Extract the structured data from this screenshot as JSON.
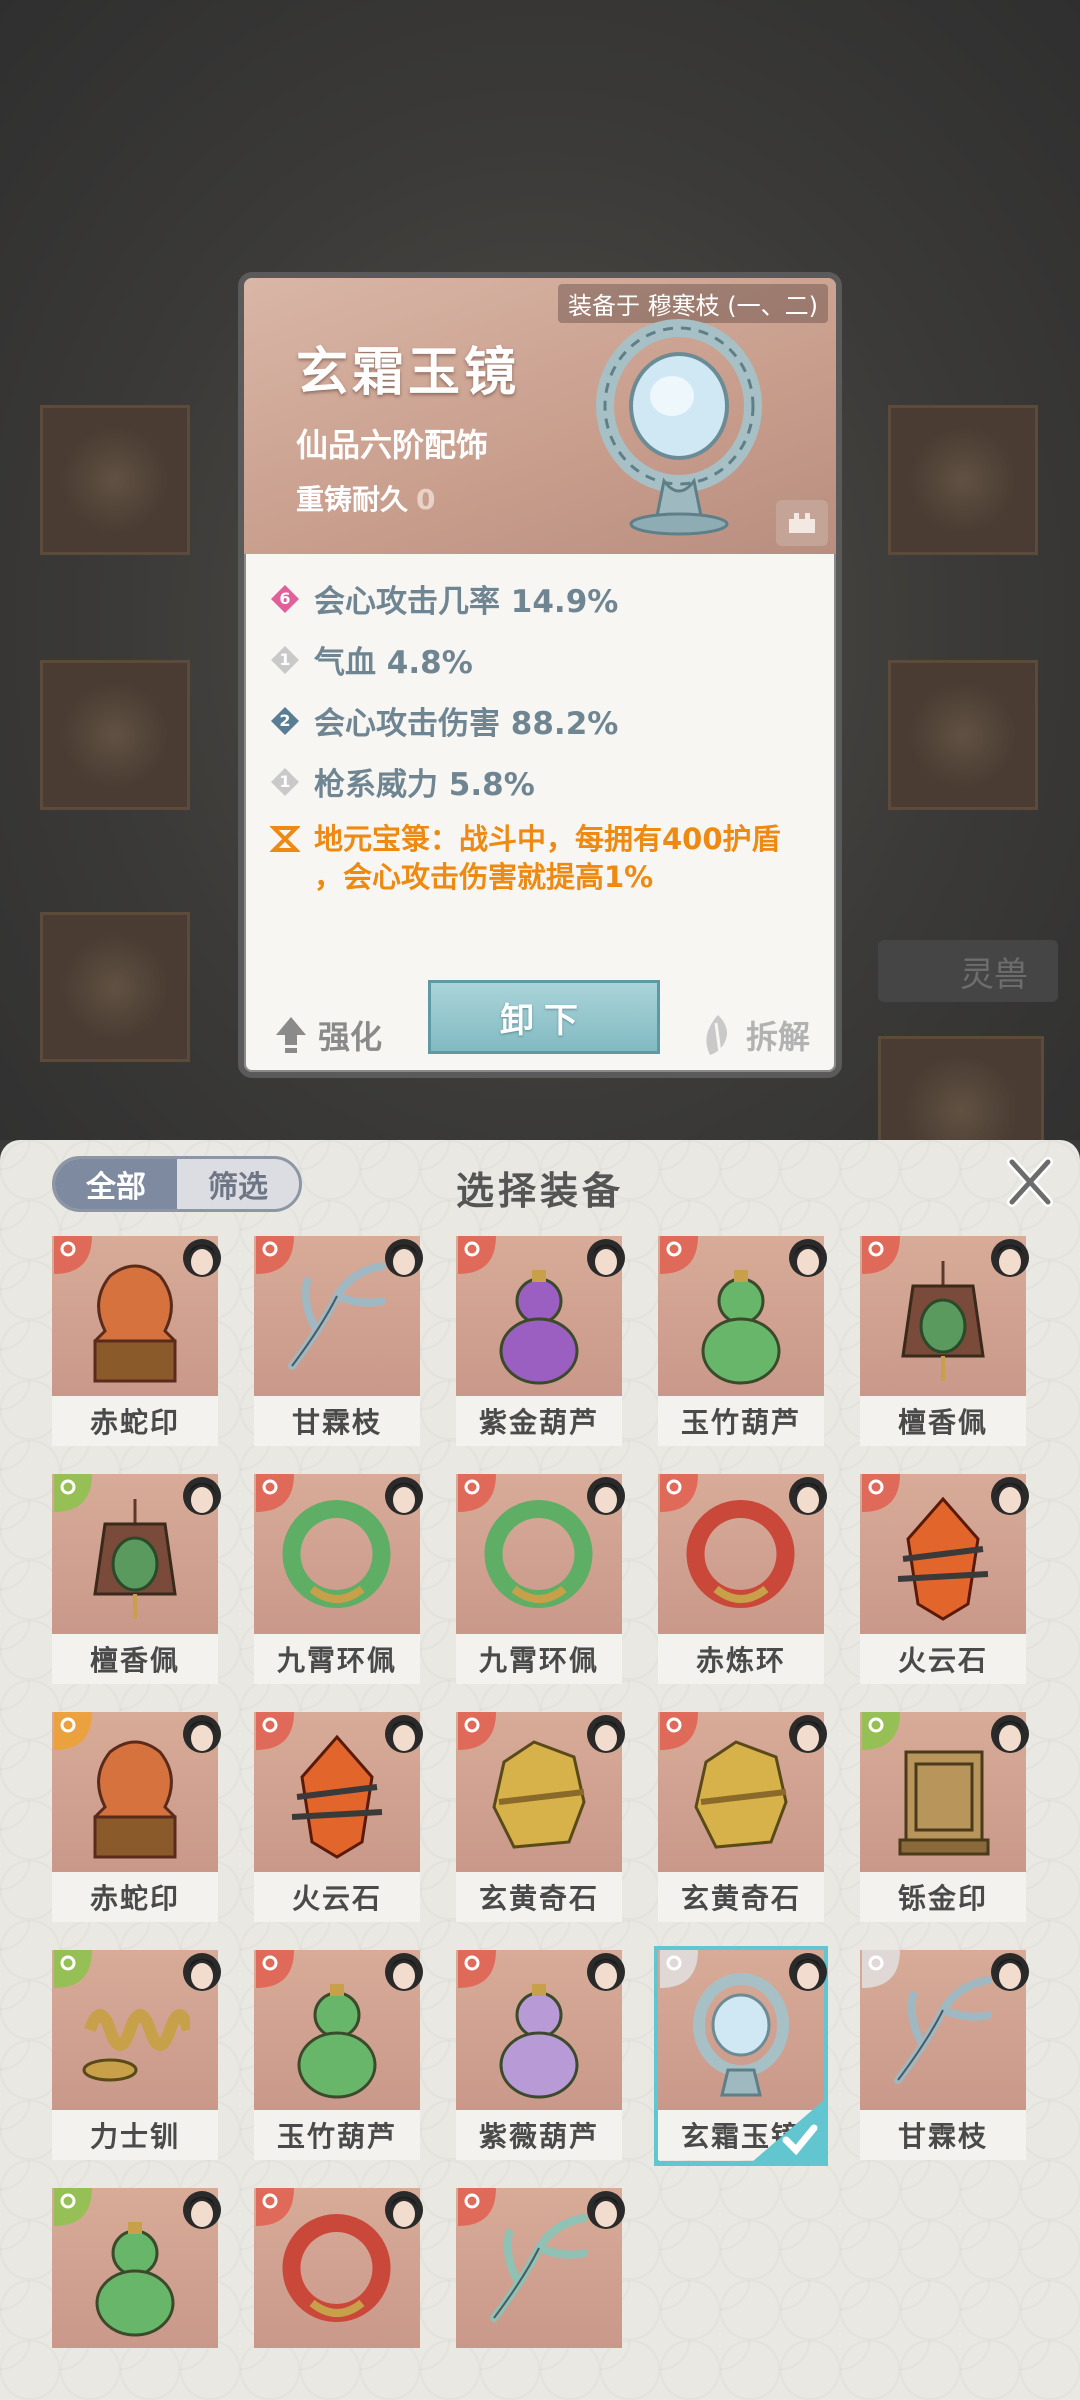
{
  "detail": {
    "equipped_on": "装备于 穆寒枝 (一、二)",
    "name": "玄霜玉镜",
    "grade": "仙品六阶配饰",
    "durability_label": "重铸耐久",
    "durability_value": "0",
    "stats": [
      {
        "level": "6",
        "text": "会心攻击几率 14.9%",
        "gem_color": "#e0609a"
      },
      {
        "level": "1",
        "text": "气血 4.8%",
        "gem_color": "#c9c9c9"
      },
      {
        "level": "2",
        "text": "会心攻击伤害 88.2%",
        "gem_color": "#5a7d96"
      },
      {
        "level": "1",
        "text": "枪系威力 5.8%",
        "gem_color": "#c9c9c9"
      }
    ],
    "special_line1": "地元宝箓：战斗中，每拥有400护盾",
    "special_line2": "，会心攻击伤害就提高1%",
    "strengthen_label": "强化",
    "unequip_label": "卸下",
    "dismantle_label": "拆解"
  },
  "background": {
    "beast_label": "灵兽"
  },
  "panel": {
    "tab_all": "全部",
    "tab_filter": "筛选",
    "title": "选择装备"
  },
  "items": [
    {
      "name": "赤蛇印",
      "kind": "seal",
      "color": "#d5723e"
    },
    {
      "name": "甘霖枝",
      "kind": "branch",
      "color": "#9fb8c2"
    },
    {
      "name": "紫金葫芦",
      "kind": "gourd",
      "color": "#9a5fc0"
    },
    {
      "name": "玉竹葫芦",
      "kind": "gourd",
      "color": "#67b66a"
    },
    {
      "name": "檀香佩",
      "kind": "pendant",
      "color": "#5a9a5e"
    },
    {
      "name": "檀香佩",
      "kind": "pendant",
      "color": "#5a9a5e"
    },
    {
      "name": "九霄环佩",
      "kind": "ring",
      "color": "#5fae66"
    },
    {
      "name": "九霄环佩",
      "kind": "ring",
      "color": "#5fae66"
    },
    {
      "name": "赤炼环",
      "kind": "ring",
      "color": "#c9483a"
    },
    {
      "name": "火云石",
      "kind": "crystal",
      "color": "#e2652b"
    },
    {
      "name": "赤蛇印",
      "kind": "seal",
      "color": "#d5723e"
    },
    {
      "name": "火云石",
      "kind": "crystal",
      "color": "#e2652b"
    },
    {
      "name": "玄黄奇石",
      "kind": "rock",
      "color": "#d7b24a"
    },
    {
      "name": "玄黄奇石",
      "kind": "rock",
      "color": "#d7b24a"
    },
    {
      "name": "铄金印",
      "kind": "box",
      "color": "#b8955a"
    },
    {
      "name": "力士钏",
      "kind": "coil",
      "color": "#c9a04a"
    },
    {
      "name": "玉竹葫芦",
      "kind": "gourd",
      "color": "#67b66a"
    },
    {
      "name": "紫薇葫芦",
      "kind": "gourd",
      "color": "#b89ad6"
    },
    {
      "name": "玄霜玉镜",
      "kind": "mirror",
      "color": "#bcd6dc",
      "selected": true
    },
    {
      "name": "甘霖枝",
      "kind": "branch",
      "color": "#9fb8c2"
    },
    {
      "name": "",
      "kind": "gourd",
      "color": "#67b66a"
    },
    {
      "name": "",
      "kind": "ring",
      "color": "#c9483a"
    },
    {
      "name": "",
      "kind": "branch",
      "color": "#8fc2b4"
    }
  ]
}
